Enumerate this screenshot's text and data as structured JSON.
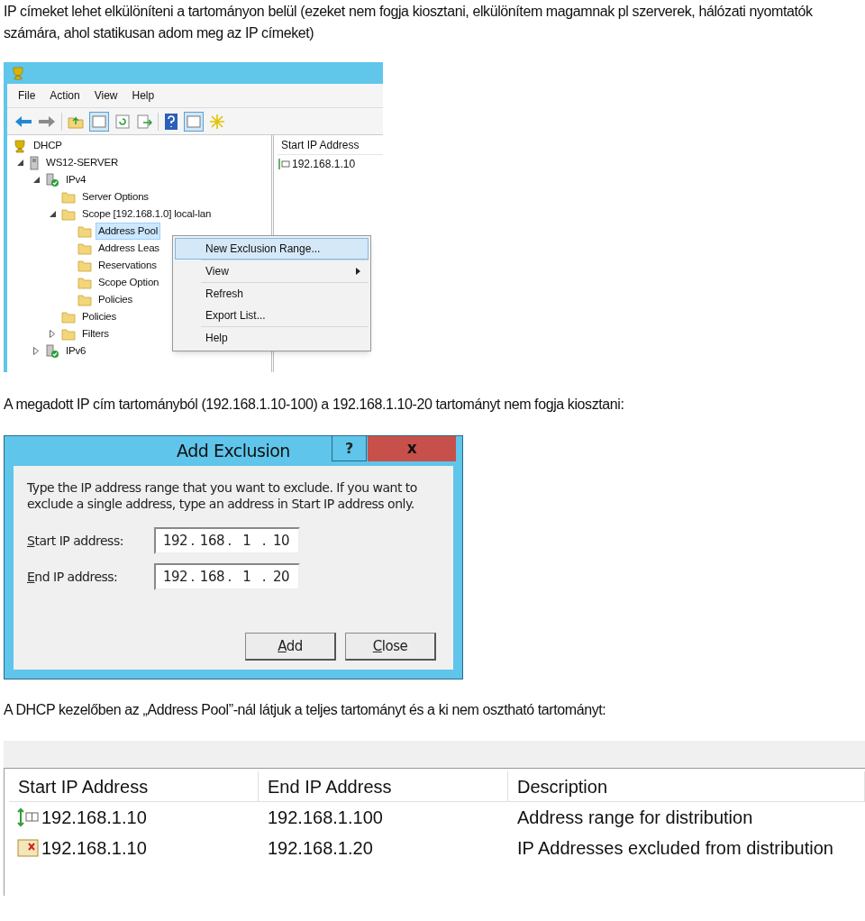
{
  "intro": "IP címeket lehet elkülöníteni a tartományon belül (ezeket nem fogja kiosztani, elkülönítem magamnak pl szerverek, hálózati nyomtatók számára, ahol statikusan adom meg az IP címeket)",
  "console": {
    "menu_bar": [
      "File",
      "Action",
      "View",
      "Help"
    ],
    "tree": [
      {
        "label": "DHCP",
        "kind": "root",
        "selected": false,
        "children": [
          {
            "label": "WS12-SERVER",
            "kind": "server",
            "selected": false,
            "expanded": true,
            "children": [
              {
                "label": "IPv4",
                "kind": "protocol",
                "selected": false,
                "expanded": true,
                "children": [
                  {
                    "label": "Server Options",
                    "kind": "folder",
                    "selected": false
                  },
                  {
                    "label": "Scope [192.168.1.0] local-lan",
                    "kind": "folder",
                    "selected": false,
                    "expanded": true,
                    "children": [
                      {
                        "label": "Address Pool",
                        "kind": "folder",
                        "selected": true
                      },
                      {
                        "label": "Address Leas",
                        "kind": "folder",
                        "selected": false
                      },
                      {
                        "label": "Reservations",
                        "kind": "folder",
                        "selected": false
                      },
                      {
                        "label": "Scope Option",
                        "kind": "folder",
                        "selected": false
                      },
                      {
                        "label": "Policies",
                        "kind": "folder",
                        "selected": false
                      }
                    ]
                  },
                  {
                    "label": "Policies",
                    "kind": "folder",
                    "selected": false
                  },
                  {
                    "label": "Filters",
                    "kind": "folder",
                    "selected": false,
                    "expanded": false
                  }
                ]
              },
              {
                "label": "IPv6",
                "kind": "protocol",
                "selected": false,
                "expanded": false
              }
            ]
          }
        ]
      }
    ],
    "list_header": "Start IP Address",
    "list_rows": [
      "192.168.1.10"
    ],
    "context_menu": [
      [
        {
          "label": "New Exclusion Range...",
          "selected": true,
          "submenu": false
        }
      ],
      [
        {
          "label": "View",
          "selected": false,
          "submenu": true
        }
      ],
      [
        {
          "label": "Refresh",
          "selected": false,
          "submenu": false
        },
        {
          "label": "Export List...",
          "selected": false,
          "submenu": false
        }
      ],
      [
        {
          "label": "Help",
          "selected": false,
          "submenu": false
        }
      ]
    ]
  },
  "middle": "A megadott IP cím tartományból (192.168.1.10-100) a 192.168.1.10-20 tartományt nem fogja kiosztani:",
  "dialog": {
    "title": "Add Exclusion",
    "help_button": "?",
    "close_button": "x",
    "description": "Type the IP address range that you want to exclude. If you want to exclude a single address, type an address in Start IP address only.",
    "fields": [
      {
        "label": "Start IP address:",
        "octets": [
          "192",
          "168",
          "1",
          "10"
        ]
      },
      {
        "label": "End IP address:",
        "octets": [
          "192",
          "168",
          "1",
          "20"
        ]
      }
    ],
    "separator": ".",
    "buttons": [
      "Add",
      "Close"
    ]
  },
  "outro": "A DHCP kezelőben az „Address Pool”-nál látjuk a teljes tartományt és a ki nem osztható tartományt:",
  "pool": {
    "columns": [
      "Start IP Address",
      "End IP Address",
      "Description"
    ],
    "rows": [
      {
        "kind": "range",
        "cells": [
          "192.168.1.10",
          "192.168.1.100",
          "Address range for distribution"
        ]
      },
      {
        "kind": "exclusion",
        "cells": [
          "192.168.1.10",
          "192.168.1.20",
          "IP Addresses excluded from distribution"
        ]
      }
    ]
  }
}
